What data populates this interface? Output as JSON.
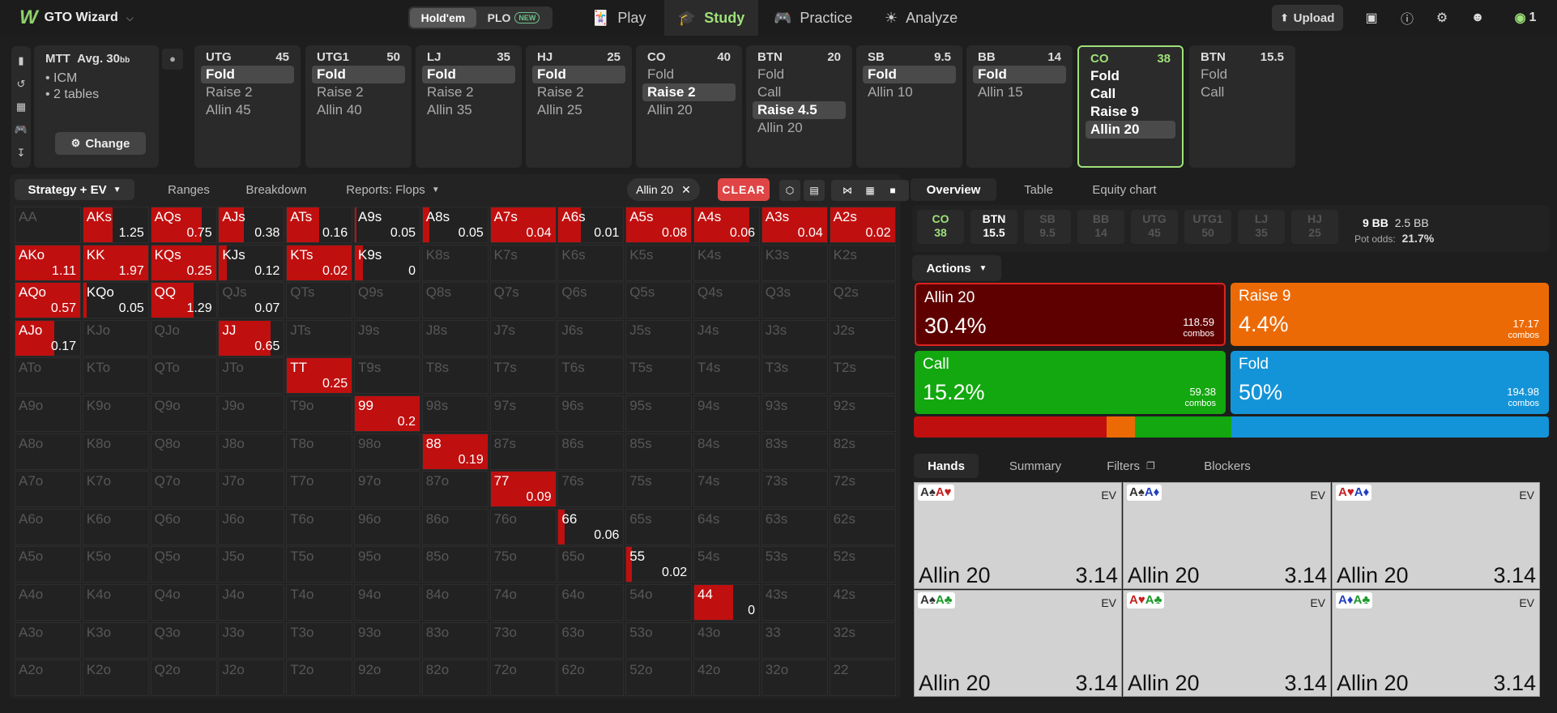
{
  "app": {
    "title": "GTO Wizard"
  },
  "topbar": {
    "game_tabs": [
      {
        "label": "Hold'em"
      },
      {
        "label": "PLO",
        "badge": "NEW"
      }
    ],
    "nav": [
      {
        "label": "Play",
        "icon": "cards-icon"
      },
      {
        "label": "Study",
        "icon": "graduation-cap-icon"
      },
      {
        "label": "Practice",
        "icon": "gamepad-icon"
      },
      {
        "label": "Analyze",
        "icon": "lightbulb-icon"
      }
    ],
    "upload_label": "Upload"
  },
  "tournament": {
    "type": "MTT",
    "avg_label": "Avg. 30",
    "avg_unit": "bb",
    "options": [
      "ICM",
      "2 tables"
    ],
    "change_label": "Change"
  },
  "seats": [
    {
      "pos": "UTG",
      "stack": "45",
      "actions": [
        "Fold",
        "Raise 2",
        "Allin 45"
      ],
      "selected": 0
    },
    {
      "pos": "UTG1",
      "stack": "50",
      "actions": [
        "Fold",
        "Raise 2",
        "Allin 40"
      ],
      "selected": 0
    },
    {
      "pos": "LJ",
      "stack": "35",
      "actions": [
        "Fold",
        "Raise 2",
        "Allin 35"
      ],
      "selected": 0
    },
    {
      "pos": "HJ",
      "stack": "25",
      "actions": [
        "Fold",
        "Raise 2",
        "Allin 25"
      ],
      "selected": 0
    },
    {
      "pos": "CO",
      "stack": "40",
      "actions": [
        "Fold",
        "Raise 2",
        "Allin 20"
      ],
      "selected": 1
    },
    {
      "pos": "BTN",
      "stack": "20",
      "actions": [
        "Fold",
        "Call",
        "Raise 4.5",
        "Allin 20"
      ],
      "selected": 2
    },
    {
      "pos": "SB",
      "stack": "9.5",
      "actions": [
        "Fold",
        "Allin 10"
      ],
      "selected": 0
    },
    {
      "pos": "BB",
      "stack": "14",
      "actions": [
        "Fold",
        "Allin 15"
      ],
      "selected": 0
    },
    {
      "pos": "CO",
      "stack": "38",
      "actions": [
        "Fold",
        "Call",
        "Raise 9",
        "Allin 20"
      ],
      "selected": 3,
      "active": true
    },
    {
      "pos": "BTN",
      "stack": "15.5",
      "actions": [
        "Fold",
        "Call"
      ],
      "selected": -1
    }
  ],
  "left_tabs": {
    "strategy": "Strategy + EV",
    "ranges": "Ranges",
    "breakdown": "Breakdown",
    "reports": "Reports: Flops",
    "filter_chip": "Allin 20",
    "clear": "CLEAR"
  },
  "grid": {
    "hands": [
      [
        "AA",
        "AKs",
        "AQs",
        "AJs",
        "ATs",
        "A9s",
        "A8s",
        "A7s",
        "A6s",
        "A5s",
        "A4s",
        "A3s",
        "A2s"
      ],
      [
        "AKo",
        "KK",
        "KQs",
        "KJs",
        "KTs",
        "K9s",
        "K8s",
        "K7s",
        "K6s",
        "K5s",
        "K4s",
        "K3s",
        "K2s"
      ],
      [
        "AQo",
        "KQo",
        "QQ",
        "QJs",
        "QTs",
        "Q9s",
        "Q8s",
        "Q7s",
        "Q6s",
        "Q5s",
        "Q4s",
        "Q3s",
        "Q2s"
      ],
      [
        "AJo",
        "KJo",
        "QJo",
        "JJ",
        "JTs",
        "J9s",
        "J8s",
        "J7s",
        "J6s",
        "J5s",
        "J4s",
        "J3s",
        "J2s"
      ],
      [
        "ATo",
        "KTo",
        "QTo",
        "JTo",
        "TT",
        "T9s",
        "T8s",
        "T7s",
        "T6s",
        "T5s",
        "T4s",
        "T3s",
        "T2s"
      ],
      [
        "A9o",
        "K9o",
        "Q9o",
        "J9o",
        "T9o",
        "99",
        "98s",
        "97s",
        "96s",
        "95s",
        "94s",
        "93s",
        "92s"
      ],
      [
        "A8o",
        "K8o",
        "Q8o",
        "J8o",
        "T8o",
        "98o",
        "88",
        "87s",
        "86s",
        "85s",
        "84s",
        "83s",
        "82s"
      ],
      [
        "A7o",
        "K7o",
        "Q7o",
        "J7o",
        "T7o",
        "97o",
        "87o",
        "77",
        "76s",
        "75s",
        "74s",
        "73s",
        "72s"
      ],
      [
        "A6o",
        "K6o",
        "Q6o",
        "J6o",
        "T6o",
        "96o",
        "86o",
        "76o",
        "66",
        "65s",
        "64s",
        "63s",
        "62s"
      ],
      [
        "A5o",
        "K5o",
        "Q5o",
        "J5o",
        "T5o",
        "95o",
        "85o",
        "75o",
        "65o",
        "55",
        "54s",
        "53s",
        "52s"
      ],
      [
        "A4o",
        "K4o",
        "Q4o",
        "J4o",
        "T4o",
        "94o",
        "84o",
        "74o",
        "64o",
        "54o",
        "44",
        "43s",
        "42s"
      ],
      [
        "A3o",
        "K3o",
        "Q3o",
        "J3o",
        "T3o",
        "93o",
        "83o",
        "73o",
        "63o",
        "53o",
        "43o",
        "33",
        "32s"
      ],
      [
        "A2o",
        "K2o",
        "Q2o",
        "J2o",
        "T2o",
        "92o",
        "82o",
        "72o",
        "62o",
        "52o",
        "42o",
        "32o",
        "22"
      ]
    ],
    "evs": {
      "AKs": "1.25",
      "AQs": "0.75",
      "AJs": "0.38",
      "ATs": "0.16",
      "A9s": "0.05",
      "A8s": "0.05",
      "A7s": "0.04",
      "A6s": "0.01",
      "A5s": "0.08",
      "A4s": "0.06",
      "A3s": "0.04",
      "A2s": "0.02",
      "AKo": "1.11",
      "KK": "1.97",
      "KQs": "0.25",
      "KJs": "0.12",
      "KTs": "0.02",
      "K9s": "0",
      "AQo": "0.57",
      "KQo": "0.05",
      "QQ": "1.29",
      "QJs": "0.07",
      "AJo": "0.17",
      "JJ": "0.65",
      "TT": "0.25",
      "99": "0.2",
      "88": "0.19",
      "77": "0.09",
      "66": "0.06",
      "55": "0.02",
      "44": "0"
    },
    "fill": {
      "AKs": 0.45,
      "AQs": 0.78,
      "AJs": 0.38,
      "ATs": 0.5,
      "A9s": 0.02,
      "A8s": 0.1,
      "A7s": 1.0,
      "A6s": 0.35,
      "A5s": 1.0,
      "A4s": 0.85,
      "A3s": 1.0,
      "A2s": 1.0,
      "AKo": 1.0,
      "KK": 1.0,
      "KQs": 1.0,
      "KJs": 0.12,
      "KTs": 1.0,
      "K9s": 0.12,
      "AQo": 1.0,
      "KQo": 0.05,
      "QQ": 0.65,
      "QJs": 0.0,
      "AJo": 0.6,
      "JJ": 0.8,
      "TT": 1.0,
      "99": 1.0,
      "88": 1.0,
      "77": 1.0,
      "66": 0.1,
      "55": 0.08,
      "44": 0.6
    }
  },
  "right_tabs": {
    "overview": "Overview",
    "table": "Table",
    "equity": "Equity chart"
  },
  "positions": [
    {
      "pos": "CO",
      "stack": "38",
      "style": "hi"
    },
    {
      "pos": "BTN",
      "stack": "15.5",
      "style": "wh"
    },
    {
      "pos": "SB",
      "stack": "9.5",
      "style": "dim"
    },
    {
      "pos": "BB",
      "stack": "14",
      "style": "dim"
    },
    {
      "pos": "UTG",
      "stack": "45",
      "style": "dim"
    },
    {
      "pos": "UTG1",
      "stack": "50",
      "style": "dim"
    },
    {
      "pos": "LJ",
      "stack": "35",
      "style": "dim"
    },
    {
      "pos": "HJ",
      "stack": "25",
      "style": "dim"
    }
  ],
  "pot": {
    "bb": "9 BB",
    "bb2": "2.5 BB",
    "odds_label": "Pot odds:",
    "odds": "21.7%"
  },
  "actions_label": "Actions",
  "action_boxes": [
    {
      "name": "Allin 20",
      "pct": "30.4%",
      "combos": "118.59",
      "unit": "combos",
      "color": "#5e0000"
    },
    {
      "name": "Raise 9",
      "pct": "4.4%",
      "combos": "17.17",
      "unit": "combos",
      "color": "#ec6a05"
    },
    {
      "name": "Call",
      "pct": "15.2%",
      "combos": "59.38",
      "unit": "combos",
      "color": "#13a80f"
    },
    {
      "name": "Fold",
      "pct": "50%",
      "combos": "194.98",
      "unit": "combos",
      "color": "#1494d8"
    }
  ],
  "freq_bar": [
    {
      "frac": 0.304,
      "color": "#c00f0f"
    },
    {
      "frac": 0.044,
      "color": "#ec6a05"
    },
    {
      "frac": 0.152,
      "color": "#13a80f"
    },
    {
      "frac": 0.5,
      "color": "#1494d8"
    }
  ],
  "hand_tabs": {
    "hands": "Hands",
    "summary": "Summary",
    "filters": "Filters",
    "blockers": "Blockers"
  },
  "hand_cards": [
    {
      "c1": "A♠",
      "c1c": "blk",
      "c2": "A♥",
      "c2c": "red",
      "ev": "EV",
      "action": "Allin 20",
      "value": "3.14"
    },
    {
      "c1": "A♠",
      "c1c": "blk",
      "c2": "A♦",
      "c2c": "blu",
      "ev": "EV",
      "action": "Allin 20",
      "value": "3.14"
    },
    {
      "c1": "A♥",
      "c1c": "red",
      "c2": "A♦",
      "c2c": "blu",
      "ev": "EV",
      "action": "Allin 20",
      "value": "3.14"
    },
    {
      "c1": "A♠",
      "c1c": "blk",
      "c2": "A♣",
      "c2c": "grn",
      "ev": "EV",
      "action": "Allin 20",
      "value": "3.14"
    },
    {
      "c1": "A♥",
      "c1c": "red",
      "c2": "A♣",
      "c2c": "grn",
      "ev": "EV",
      "action": "Allin 20",
      "value": "3.14"
    },
    {
      "c1": "A♦",
      "c1c": "blu",
      "c2": "A♣",
      "c2c": "grn",
      "ev": "EV",
      "action": "Allin 20",
      "value": "3.14"
    }
  ]
}
